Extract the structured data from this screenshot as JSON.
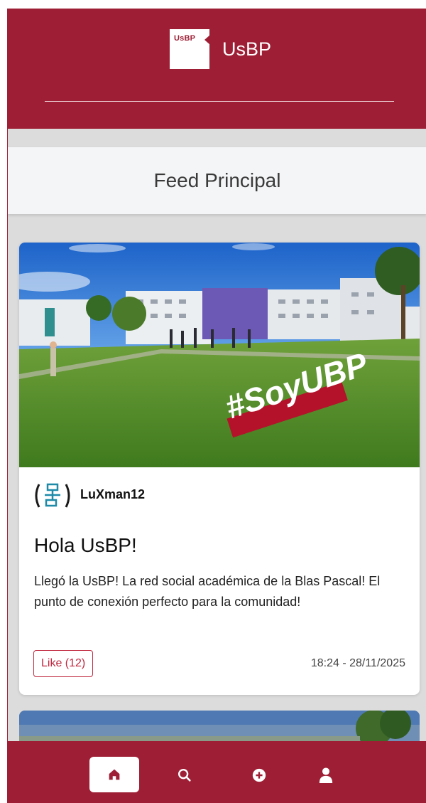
{
  "header": {
    "logo_text": "UsBP",
    "brand_name": "UsBP"
  },
  "page": {
    "title": "Feed Principal"
  },
  "posts": [
    {
      "image_caption": "#SoyUBP",
      "author": "LuXman12",
      "title": "Hola UsBP!",
      "body": "Llegó la UsBP! La red social académica de la Blas Pascal! El punto de conexión perfecto para la comunidad!",
      "like_label": "Like (12)",
      "timestamp": "18:24 - 28/11/2025"
    }
  ],
  "nav": {
    "items": [
      {
        "icon": "home-icon",
        "active": true
      },
      {
        "icon": "search-icon",
        "active": false
      },
      {
        "icon": "add-circle-icon",
        "active": false
      },
      {
        "icon": "user-icon",
        "active": false
      }
    ]
  },
  "colors": {
    "brand": "#9e1f35",
    "like": "#c0283f",
    "background": "#dcdcdc"
  }
}
